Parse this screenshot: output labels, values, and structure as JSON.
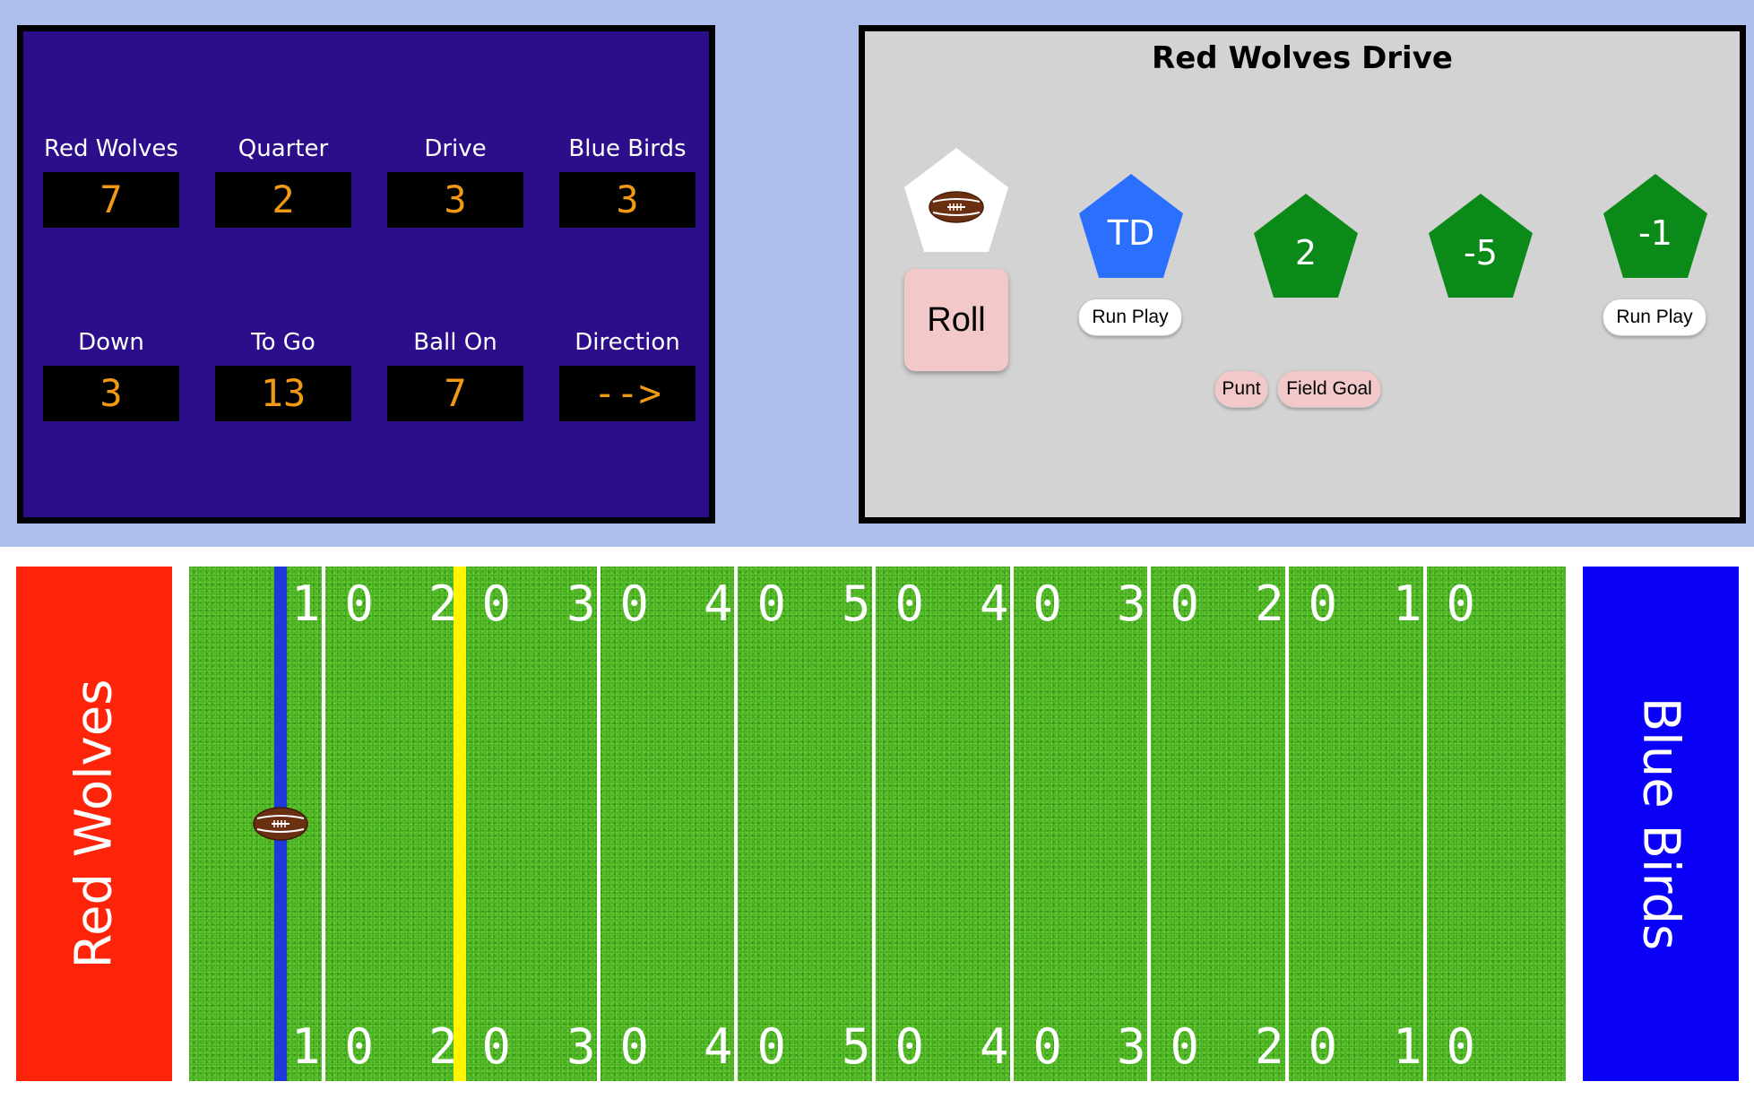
{
  "scoreboard": {
    "cells": [
      {
        "label": "Red Wolves",
        "value": "7"
      },
      {
        "label": "Quarter",
        "value": "2"
      },
      {
        "label": "Drive",
        "value": "3"
      },
      {
        "label": "Blue Birds",
        "value": "3"
      },
      {
        "label": "Down",
        "value": "3"
      },
      {
        "label": "To Go",
        "value": "13"
      },
      {
        "label": "Ball On",
        "value": "7"
      },
      {
        "label": "Direction",
        "value": "-->"
      }
    ],
    "colors": {
      "background": "#2d0e8a",
      "digits": "#f09a14"
    }
  },
  "drive": {
    "title": "Red Wolves Drive",
    "dice": [
      {
        "face": "TD",
        "color": "#2b6fff"
      },
      {
        "face": "2",
        "color": "#0b8a1a"
      },
      {
        "face": "-5",
        "color": "#0b8a1a"
      },
      {
        "face": "-1",
        "color": "#0b8a1a"
      }
    ],
    "roll_label": "Roll",
    "run_play_label": "Run Play",
    "punt_label": "Punt",
    "field_goal_label": "Field Goal",
    "football_die_icon": "football-icon"
  },
  "field": {
    "left_team": "Red Wolves",
    "right_team": "Blue Birds",
    "left_color": "#fd2409",
    "right_color": "#0a00f8",
    "yard_numbers": [
      "10",
      "20",
      "30",
      "40",
      "50",
      "40",
      "30",
      "20",
      "10"
    ],
    "ball_on_yard": 7,
    "first_down_yard": 20,
    "line_of_scrimmage_color": "#1e3ad8",
    "first_down_color": "#fff600"
  }
}
